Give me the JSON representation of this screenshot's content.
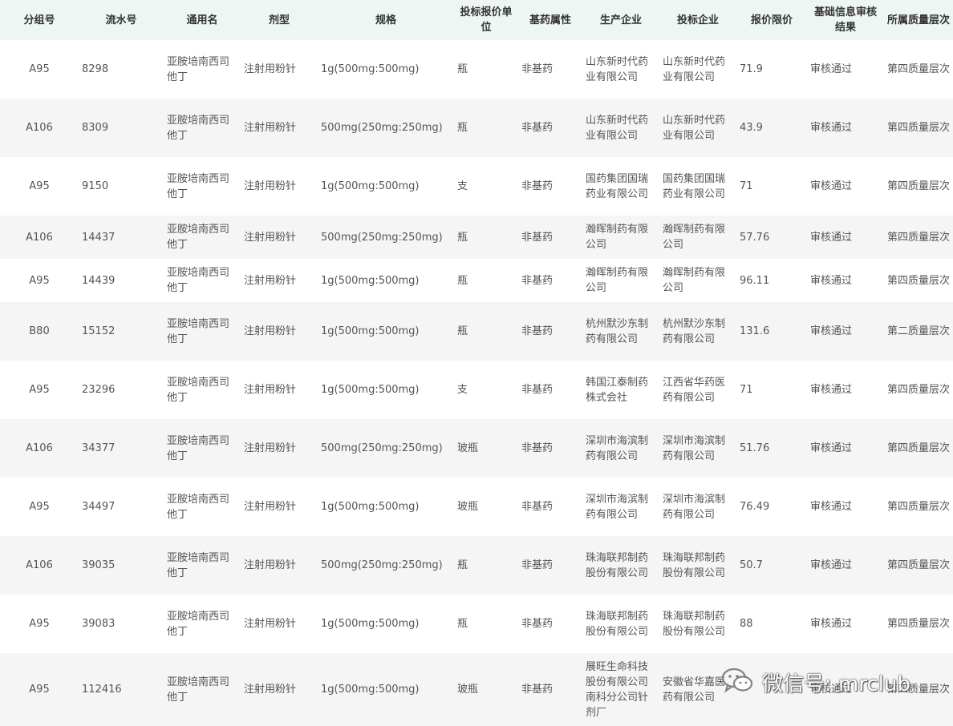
{
  "headers": [
    "分组号",
    "流水号",
    "通用名",
    "剂型",
    "规格",
    "投标报价单位",
    "基药属性",
    "生产企业",
    "投标企业",
    "报价限价",
    "基础信息审核结果",
    "所属质量层次"
  ],
  "rows": [
    {
      "group": "A95",
      "serial": "8298",
      "name": "亚胺培南西司他丁",
      "form": "注射用粉针",
      "spec": "1g(500mg:500mg)",
      "unit": "瓶",
      "essential": "非基药",
      "manufacturer": "山东新时代药业有限公司",
      "bidder": "山东新时代药业有限公司",
      "price": "71.9",
      "review": "审核通过",
      "quality": "第四质量层次"
    },
    {
      "group": "A106",
      "serial": "8309",
      "name": "亚胺培南西司他丁",
      "form": "注射用粉针",
      "spec": "500mg(250mg:250mg)",
      "unit": "瓶",
      "essential": "非基药",
      "manufacturer": "山东新时代药业有限公司",
      "bidder": "山东新时代药业有限公司",
      "price": "43.9",
      "review": "审核通过",
      "quality": "第四质量层次"
    },
    {
      "group": "A95",
      "serial": "9150",
      "name": "亚胺培南西司他丁",
      "form": "注射用粉针",
      "spec": "1g(500mg:500mg)",
      "unit": "支",
      "essential": "非基药",
      "manufacturer": "国药集团国瑞药业有限公司",
      "bidder": "国药集团国瑞药业有限公司",
      "price": "71",
      "review": "审核通过",
      "quality": "第四质量层次"
    },
    {
      "group": "A106",
      "serial": "14437",
      "name": "亚胺培南西司他丁",
      "form": "注射用粉针",
      "spec": "500mg(250mg:250mg)",
      "unit": "瓶",
      "essential": "非基药",
      "manufacturer": "瀚晖制药有限公司",
      "bidder": "瀚晖制药有限公司",
      "price": "57.76",
      "review": "审核通过",
      "quality": "第四质量层次"
    },
    {
      "group": "A95",
      "serial": "14439",
      "name": "亚胺培南西司他丁",
      "form": "注射用粉针",
      "spec": "1g(500mg:500mg)",
      "unit": "瓶",
      "essential": "非基药",
      "manufacturer": "瀚晖制药有限公司",
      "bidder": "瀚晖制药有限公司",
      "price": "96.11",
      "review": "审核通过",
      "quality": "第四质量层次"
    },
    {
      "group": "B80",
      "serial": "15152",
      "name": "亚胺培南西司他丁",
      "form": "注射用粉针",
      "spec": "1g(500mg:500mg)",
      "unit": "瓶",
      "essential": "非基药",
      "manufacturer": "杭州默沙东制药有限公司",
      "bidder": "杭州默沙东制药有限公司",
      "price": "131.6",
      "review": "审核通过",
      "quality": "第二质量层次"
    },
    {
      "group": "A95",
      "serial": "23296",
      "name": "亚胺培南西司他丁",
      "form": "注射用粉针",
      "spec": "1g(500mg:500mg)",
      "unit": "支",
      "essential": "非基药",
      "manufacturer": "韩国江泰制药株式会社",
      "bidder": "江西省华药医药有限公司",
      "price": "71",
      "review": "审核通过",
      "quality": "第四质量层次"
    },
    {
      "group": "A106",
      "serial": "34377",
      "name": "亚胺培南西司他丁",
      "form": "注射用粉针",
      "spec": "500mg(250mg:250mg)",
      "unit": "玻瓶",
      "essential": "非基药",
      "manufacturer": "深圳市海滨制药有限公司",
      "bidder": "深圳市海滨制药有限公司",
      "price": "51.76",
      "review": "审核通过",
      "quality": "第四质量层次"
    },
    {
      "group": "A95",
      "serial": "34497",
      "name": "亚胺培南西司他丁",
      "form": "注射用粉针",
      "spec": "1g(500mg:500mg)",
      "unit": "玻瓶",
      "essential": "非基药",
      "manufacturer": "深圳市海滨制药有限公司",
      "bidder": "深圳市海滨制药有限公司",
      "price": "76.49",
      "review": "审核通过",
      "quality": "第四质量层次"
    },
    {
      "group": "A106",
      "serial": "39035",
      "name": "亚胺培南西司他丁",
      "form": "注射用粉针",
      "spec": "500mg(250mg:250mg)",
      "unit": "瓶",
      "essential": "非基药",
      "manufacturer": "珠海联邦制药股份有限公司",
      "bidder": "珠海联邦制药股份有限公司",
      "price": "50.7",
      "review": "审核通过",
      "quality": "第四质量层次"
    },
    {
      "group": "A95",
      "serial": "39083",
      "name": "亚胺培南西司他丁",
      "form": "注射用粉针",
      "spec": "1g(500mg:500mg)",
      "unit": "瓶",
      "essential": "非基药",
      "manufacturer": "珠海联邦制药股份有限公司",
      "bidder": "珠海联邦制药股份有限公司",
      "price": "88",
      "review": "审核通过",
      "quality": "第四质量层次"
    },
    {
      "group": "A95",
      "serial": "112416",
      "name": "亚胺培南西司他丁",
      "form": "注射用粉针",
      "spec": "1g(500mg:500mg)",
      "unit": "玻瓶",
      "essential": "非基药",
      "manufacturer": "展旺生命科技股份有限公司南科分公司针剂厂",
      "bidder": "安徽省华嘉医药有限公司",
      "price": "",
      "review": "审核通过",
      "quality": "第四质量层次"
    }
  ],
  "watermark": {
    "icon": "wechat-icon",
    "text": "微信号: mrclub"
  }
}
